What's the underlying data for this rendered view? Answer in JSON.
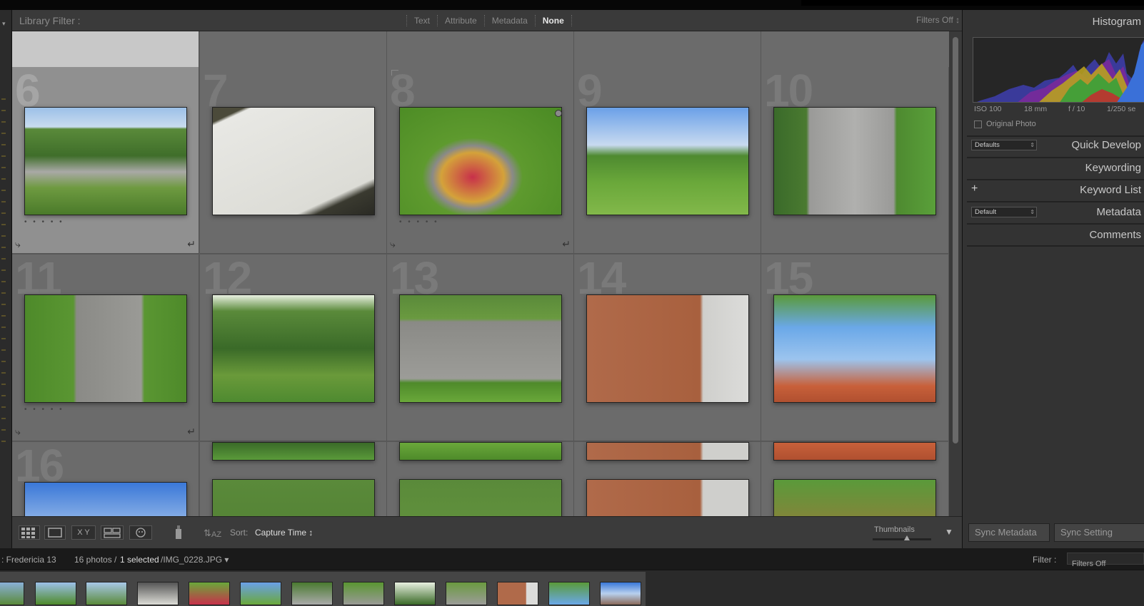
{
  "filter_bar": {
    "title": "Library Filter :",
    "tabs": [
      "Text",
      "Attribute",
      "Metadata",
      "None"
    ],
    "active_tab": "None",
    "filters_status": "Filters Off ↕"
  },
  "grid": {
    "cell_numbers": [
      "6",
      "7",
      "8",
      "9",
      "10",
      "11",
      "12",
      "13",
      "14",
      "15",
      "16"
    ]
  },
  "toolbar": {
    "sort_label": "Sort:",
    "sort_value": "Capture Time ↕",
    "thumbnails_label": "Thumbnails",
    "thumbnail_size": 0.6,
    "dropdown_glyph": "▼"
  },
  "right_panel": {
    "histogram_title": "Histogram",
    "iso": "ISO 100",
    "focal_length": "18 mm",
    "aperture": "f / 10",
    "shutter": "1/250 se",
    "original_photo": "Original Photo",
    "quick_develop_preset": "Defaults",
    "quick_develop": "Quick Develop",
    "keywording": "Keywording",
    "keyword_list": "Keyword List",
    "metadata_preset": "Default",
    "metadata": "Metadata",
    "comments": "Comments",
    "sync_metadata": "Sync Metadata",
    "sync_settings": "Sync Setting"
  },
  "status_bar": {
    "folder": ": Fredericia 13",
    "count": "16 photos /",
    "selected": "1 selected",
    "filename": " /IMG_0228.JPG ▾",
    "filter_label": "Filter :",
    "filter_value": "Filters Off"
  },
  "icons": {
    "lock": "lock-icon",
    "rotate_left": "⤷",
    "rotate_right": "↵",
    "rating_dots": "• • • • •"
  }
}
